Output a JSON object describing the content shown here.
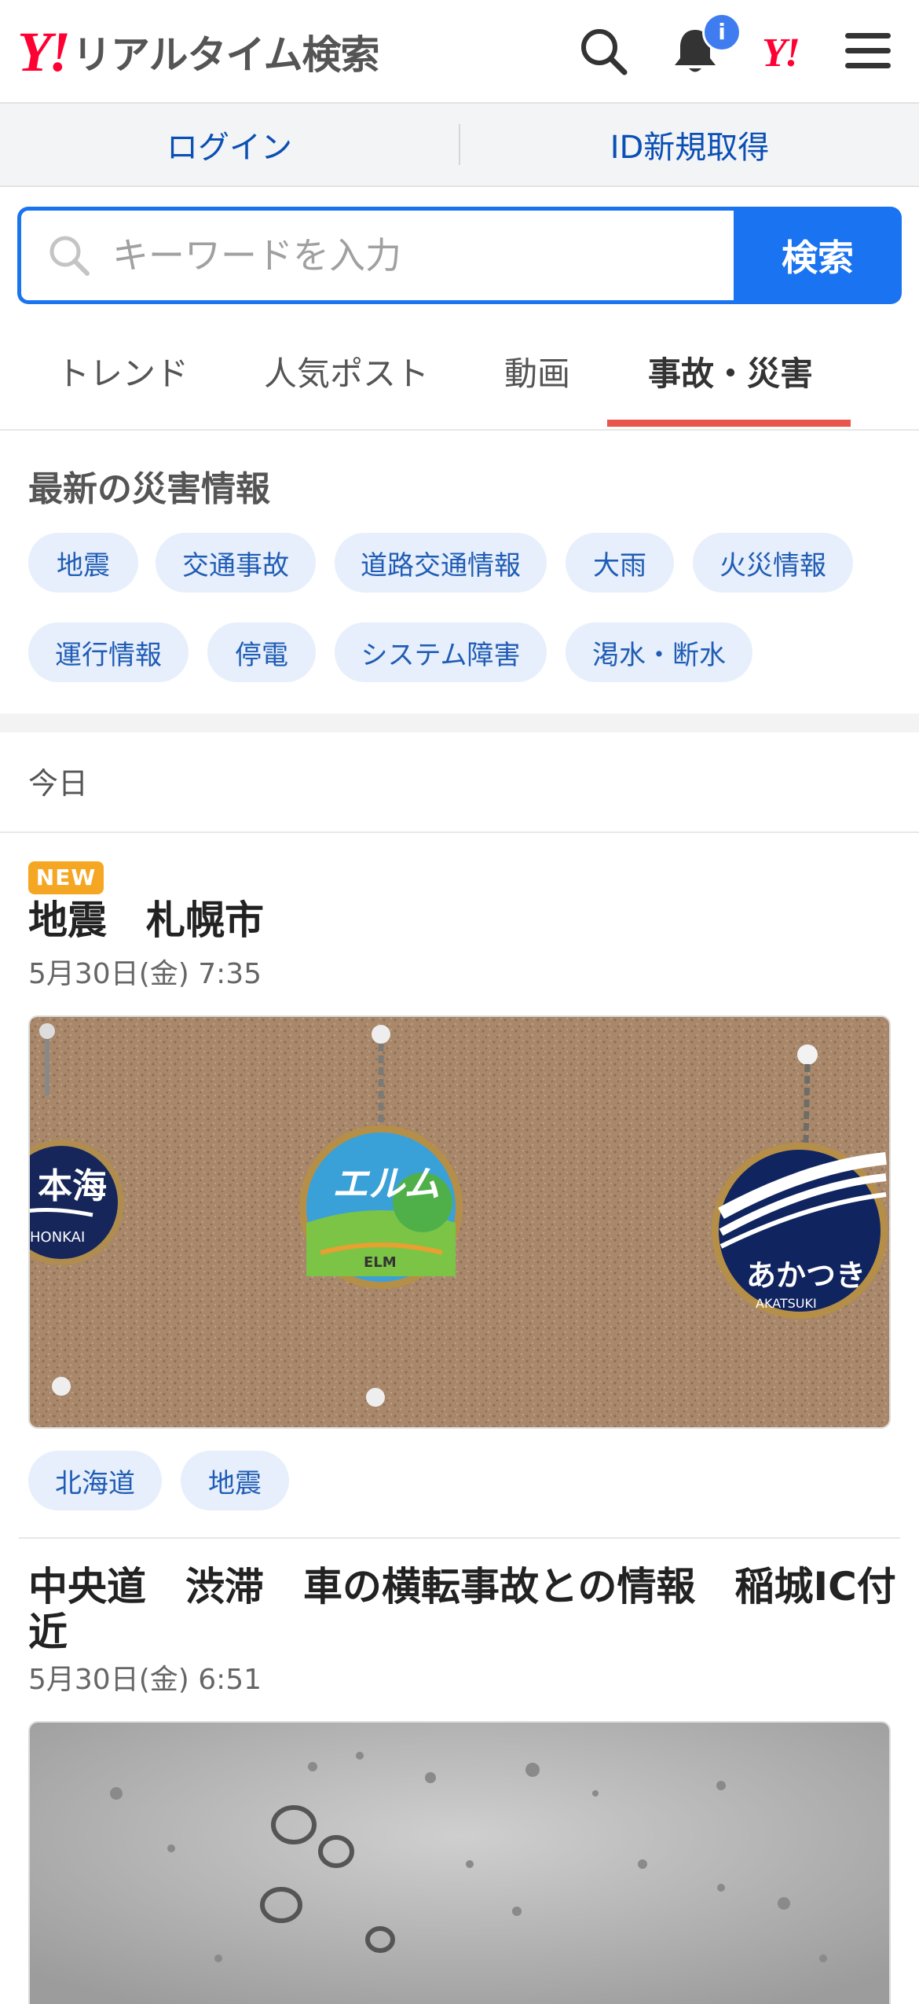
{
  "header": {
    "logo_mark": "Y!",
    "logo_text": "リアルタイム検索",
    "notification_badge": "i",
    "yahoo_mark": "Y!"
  },
  "auth": {
    "login": "ログイン",
    "register": "ID新規取得"
  },
  "search": {
    "placeholder": "キーワードを入力",
    "button": "検索"
  },
  "tabs": [
    {
      "label": "トレンド",
      "active": false
    },
    {
      "label": "人気ポスト",
      "active": false
    },
    {
      "label": "動画",
      "active": false
    },
    {
      "label": "事故・災害",
      "active": true
    }
  ],
  "disaster_info": {
    "title": "最新の災害情報",
    "chips": [
      "地震",
      "交通事故",
      "道路交通情報",
      "大雨",
      "火災情報",
      "運行情報",
      "停電",
      "システム障害",
      "渇水・断水"
    ]
  },
  "day_label": "今日",
  "articles": [
    {
      "badge": "NEW",
      "title": "地震　札幌市",
      "date": "5月30日(金) 7:35",
      "image_labels": [
        "本海",
        "HONKAI",
        "エルム",
        "ELM",
        "あかつき",
        "AKATSUKI"
      ],
      "tags": [
        "北海道",
        "地震"
      ]
    },
    {
      "title_line1": "中央道　渋滞　車の横転事故との情報　稲城IC付",
      "title_line2": "近",
      "date": "5月30日(金) 6:51"
    }
  ],
  "colors": {
    "accent": "#1a73f0",
    "brand": "#ff0033",
    "tab_underline": "#e8574c",
    "new_badge": "#f5a623"
  }
}
